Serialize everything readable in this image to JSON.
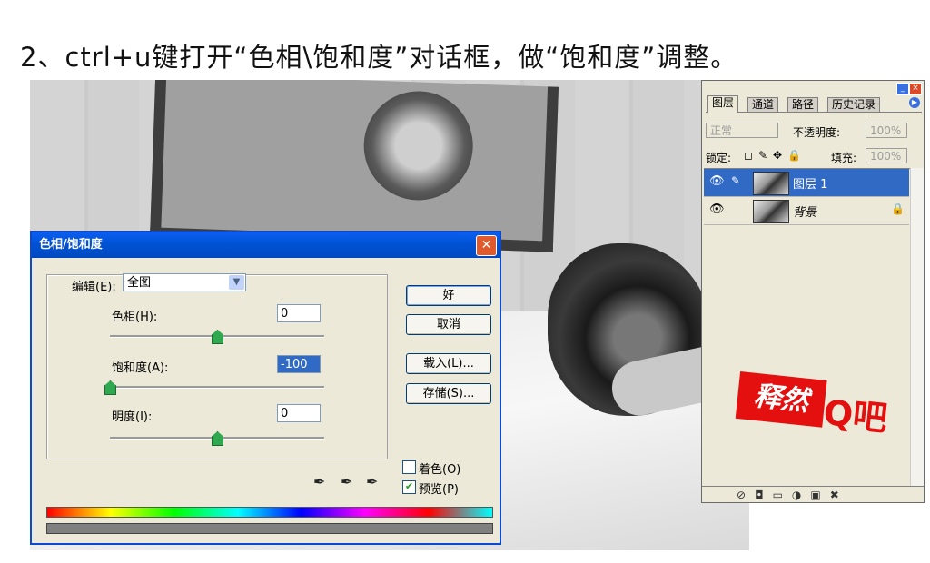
{
  "caption": "2、ctrl+u键打开“色相\\饱和度”对话框，做“饱和度”调整。",
  "dialog": {
    "title": "色相/饱和度",
    "close": "✕",
    "edit_label": "编辑(E):",
    "edit_value": "全图",
    "hue_label": "色相(H):",
    "hue_value": "0",
    "hue_level": 0.5,
    "saturation_label": "饱和度(A):",
    "saturation_value": "-100",
    "saturation_level": 0.0,
    "lightness_label": "明度(I):",
    "lightness_value": "0",
    "lightness_level": 0.5,
    "ok": "好",
    "cancel": "取消",
    "load": "载入(L)...",
    "save": "存储(S)...",
    "colorize_label": "着色(O)",
    "colorize_checked": false,
    "preview_label": "预览(P)",
    "preview_checked": true
  },
  "layers_panel": {
    "tabs": [
      "图层",
      "通道",
      "路径",
      "历史记录"
    ],
    "blend_mode": "正常",
    "opacity_label": "不透明度:",
    "opacity_value": "100%",
    "lock_label": "锁定:",
    "fill_label": "填充:",
    "fill_value": "100%",
    "layers": [
      {
        "name": "图层 1",
        "selected": true
      },
      {
        "name": "背景",
        "selected": false,
        "locked": true
      }
    ]
  },
  "watermark": {
    "red_text": "释然",
    "rest_text": "Q吧"
  },
  "colors": {
    "accent": "#0a5ef0",
    "selection": "#316ac5",
    "watermark_red": "#e41010"
  }
}
